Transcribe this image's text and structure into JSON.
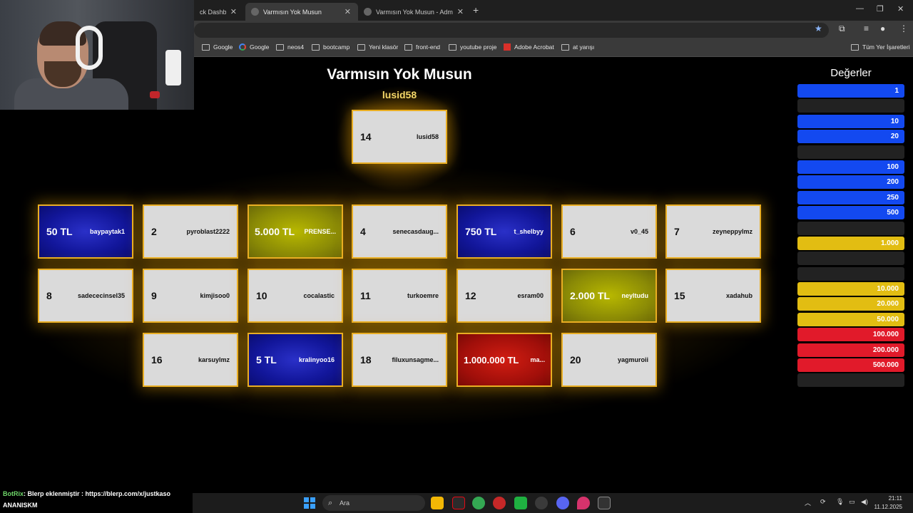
{
  "browser": {
    "tabs": [
      {
        "label": "ck Dashboard",
        "active": false
      },
      {
        "label": "Varmısın Yok Musun",
        "active": true
      },
      {
        "label": "Varmısın Yok Musun - Admin",
        "active": false
      }
    ],
    "new_tab": "+",
    "window_controls": {
      "minimize": "—",
      "restore": "❐",
      "close": "✕"
    },
    "bookmarks": [
      {
        "label": "Google",
        "icon": "folder-icon"
      },
      {
        "label": "Google",
        "icon": "google-icon"
      },
      {
        "label": "neos4",
        "icon": "folder-icon"
      },
      {
        "label": "bootcamp",
        "icon": "folder-icon"
      },
      {
        "label": "Yeni klasör",
        "icon": "folder-icon"
      },
      {
        "label": "front-end",
        "icon": "folder-icon"
      },
      {
        "label": "youtube proje",
        "icon": "folder-icon"
      },
      {
        "label": "Adobe Acrobat",
        "icon": "acrobat-icon"
      },
      {
        "label": "at yarışı",
        "icon": "folder-icon"
      }
    ],
    "all_bookmarks": "Tüm Yer İşaretleri"
  },
  "game": {
    "title": "Varmısın Yok Musun",
    "player": "lusid58",
    "player_box": {
      "num": "14",
      "name": "lusid58"
    },
    "boxes": [
      {
        "num": "50 TL",
        "name": "baypaytak1",
        "color": "blue"
      },
      {
        "num": "2",
        "name": "pyroblast2222",
        "color": "grey"
      },
      {
        "num": "5.000 TL",
        "name": "PRENSE...",
        "color": "olive"
      },
      {
        "num": "4",
        "name": "senecasdaug...",
        "color": "grey"
      },
      {
        "num": "750 TL",
        "name": "t_shelbyy",
        "color": "blue"
      },
      {
        "num": "6",
        "name": "v0_45",
        "color": "grey"
      },
      {
        "num": "7",
        "name": "zeyneppylmz",
        "color": "grey"
      },
      {
        "num": "8",
        "name": "sadececinsel35",
        "color": "grey"
      },
      {
        "num": "9",
        "name": "kimjisoo0",
        "color": "grey"
      },
      {
        "num": "10",
        "name": "cocalastic",
        "color": "grey"
      },
      {
        "num": "11",
        "name": "turkoemre",
        "color": "grey"
      },
      {
        "num": "12",
        "name": "esram00",
        "color": "grey"
      },
      {
        "num": "2.000 TL",
        "name": "neyltudu",
        "color": "olive"
      },
      {
        "num": "15",
        "name": "xadahub",
        "color": "grey"
      },
      {
        "num": "16",
        "name": "karsuylmz",
        "color": "grey"
      },
      {
        "num": "5 TL",
        "name": "kralinyoo16",
        "color": "blue"
      },
      {
        "num": "18",
        "name": "filuxunsagme...",
        "color": "grey"
      },
      {
        "num": "1.000.000 TL",
        "name": "ma...",
        "color": "red"
      },
      {
        "num": "20",
        "name": "yagmuroii",
        "color": "grey"
      }
    ]
  },
  "values_panel": {
    "title": "Değerler",
    "rows": [
      {
        "label": "1",
        "color": "blue"
      },
      {
        "label": "",
        "color": "empty"
      },
      {
        "label": "10",
        "color": "blue"
      },
      {
        "label": "20",
        "color": "blue"
      },
      {
        "label": "",
        "color": "empty"
      },
      {
        "label": "100",
        "color": "blue"
      },
      {
        "label": "200",
        "color": "blue"
      },
      {
        "label": "250",
        "color": "blue"
      },
      {
        "label": "500",
        "color": "blue"
      },
      {
        "label": "",
        "color": "empty"
      },
      {
        "label": "1.000",
        "color": "yellow"
      },
      {
        "label": "",
        "color": "empty"
      },
      {
        "label": "",
        "color": "empty"
      },
      {
        "label": "10.000",
        "color": "yellow"
      },
      {
        "label": "20.000",
        "color": "yellow"
      },
      {
        "label": "50.000",
        "color": "yellow"
      },
      {
        "label": "100.000",
        "color": "red"
      },
      {
        "label": "200.000",
        "color": "red"
      },
      {
        "label": "500.000",
        "color": "red"
      },
      {
        "label": "",
        "color": "empty"
      }
    ]
  },
  "chat": [
    {
      "user": "BotRix",
      "message": ": Blerp eklenmiştir : https://blerp.com/x/justkaso"
    },
    {
      "user": "",
      "message": "ANANISKM"
    }
  ],
  "taskbar": {
    "search_placeholder": "Ara",
    "time": "21:11",
    "date": "11.12.2025"
  },
  "colors": {
    "box_border": "#e9ae24",
    "grey_box": "#dadada",
    "blue_box": "#12169a",
    "olive_box": "#8a8a06",
    "red_box": "#a10f0a",
    "value_blue": "#1349f0",
    "value_yellow": "#e2bd12",
    "value_red": "#e11a2a"
  }
}
